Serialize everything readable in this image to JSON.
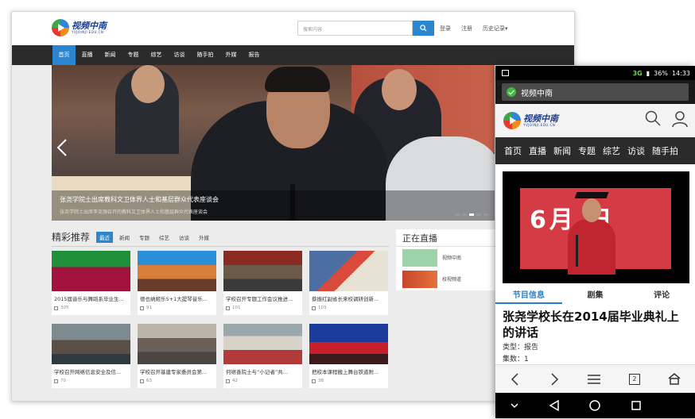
{
  "desktop": {
    "logo": {
      "text": "视频中南",
      "sub": "YVJOINJI.EDU.CN"
    },
    "search": {
      "placeholder": "搜索内容"
    },
    "top_links": [
      "登录",
      "注册",
      "历史记录▾"
    ],
    "nav": [
      "首页",
      "直播",
      "新闻",
      "专题",
      "综艺",
      "访谈",
      "随手拍",
      "外媒",
      "报告"
    ],
    "active_nav_index": 0,
    "banner": {
      "caption": "张尧学院士出席教科文卫体界人士和基层群众代表座谈会",
      "subcaption": "张尧学院士出席李克强召开的教科文卫体界人士和基层群众代表座谈会",
      "slide_count": 5,
      "active_slide": 3
    },
    "recommend": {
      "title": "精彩推荐",
      "tabs": [
        "最近",
        "新闻",
        "专题",
        "综艺",
        "访谈",
        "外媒"
      ],
      "active_tab": 0,
      "items": [
        {
          "title": "2015届音乐与舞蹈系毕业生...",
          "views": "305"
        },
        {
          "title": "德也纳姬乐5+1大提琴音乐...",
          "views": "91"
        },
        {
          "title": "学校召开专题工作会议推进...",
          "views": "101"
        },
        {
          "title": "蔡振红副省长来校调研创新...",
          "views": "103"
        },
        {
          "title": "学校召开网络信息安全及信...",
          "views": "70"
        },
        {
          "title": "学校召开基建专家委员会第...",
          "views": "63"
        },
        {
          "title": "何继善院士与“小记者”共...",
          "views": "42"
        },
        {
          "title": "把校本课程搬上舞台铁道附...",
          "views": "38"
        }
      ]
    },
    "live": {
      "title": "正在直播",
      "channels": [
        "视频中南",
        "校视频道"
      ]
    }
  },
  "mobile": {
    "status": {
      "network": "3G",
      "battery": "36%",
      "time": "14:33"
    },
    "toast": "视频中南",
    "nav": [
      "首页",
      "直播",
      "新闻",
      "专题",
      "综艺",
      "访谈",
      "随手拍"
    ],
    "video_banner_text": "6月 日",
    "tabs": [
      "节目信息",
      "剧集",
      "评论"
    ],
    "active_tab": 0,
    "title": "张尧学校长在2014届毕业典礼上的讲话",
    "meta": [
      {
        "label": "类型：",
        "value": "报告"
      },
      {
        "label": "集数：",
        "value": "1"
      }
    ],
    "bottom_tab_count": "2"
  },
  "colors": {
    "accent": "#2b86cf",
    "nav_bg": "#2b2b2b",
    "tab_active": "#2b7fc4"
  }
}
